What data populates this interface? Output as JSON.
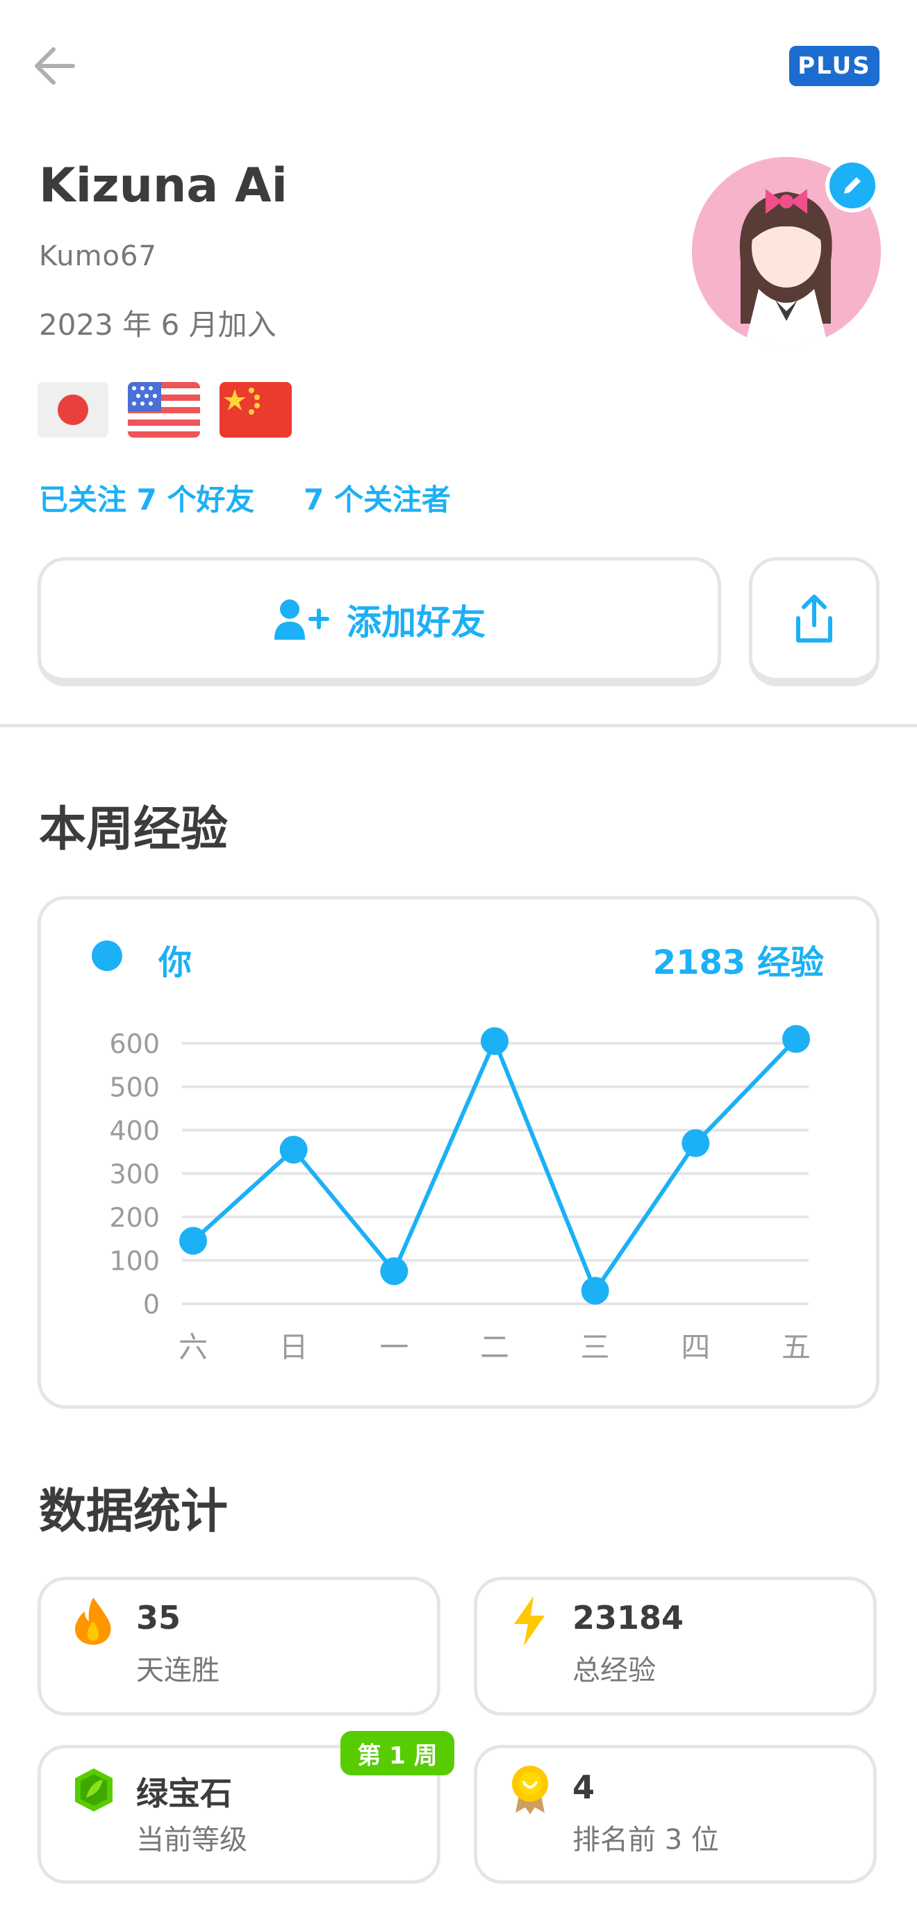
{
  "header": {
    "plus_label": "PLUS"
  },
  "profile": {
    "display_name": "Kizuna Ai",
    "username": "Kumo67",
    "joined": "2023 年 6 月加入",
    "flags": [
      "japan-flag",
      "usa-flag",
      "china-flag"
    ],
    "following": "已关注 7 个好友",
    "followers": "7 个关注者",
    "add_friend_label": "添加好友"
  },
  "weekly_xp": {
    "title": "本周经验",
    "legend_label": "你",
    "total_label": "2183 经验"
  },
  "chart_data": {
    "type": "line",
    "categories": [
      "六",
      "日",
      "一",
      "二",
      "三",
      "四",
      "五"
    ],
    "series": [
      {
        "name": "你",
        "values": [
          145,
          355,
          75,
          605,
          30,
          370,
          610
        ]
      }
    ],
    "yticks": [
      0,
      100,
      200,
      300,
      400,
      500,
      600
    ],
    "ylim": [
      0,
      600
    ],
    "grid": true,
    "color": "#1cb0f6"
  },
  "stats": {
    "title": "数据统计",
    "items": [
      {
        "icon": "fire-icon",
        "value": "35",
        "label": "天连胜"
      },
      {
        "icon": "lightning-icon",
        "value": "23184",
        "label": "总经验"
      },
      {
        "icon": "emerald-league-icon",
        "value": "绿宝石",
        "label": "当前等级",
        "badge": "第 1 周"
      },
      {
        "icon": "medal-icon",
        "value": "4",
        "label": "排名前 3 位"
      }
    ]
  },
  "colors": {
    "accent": "#1cb0f6",
    "plus_badge": "#1d6ccf",
    "badge_green": "#58cc02",
    "border": "#e5e5e5"
  }
}
